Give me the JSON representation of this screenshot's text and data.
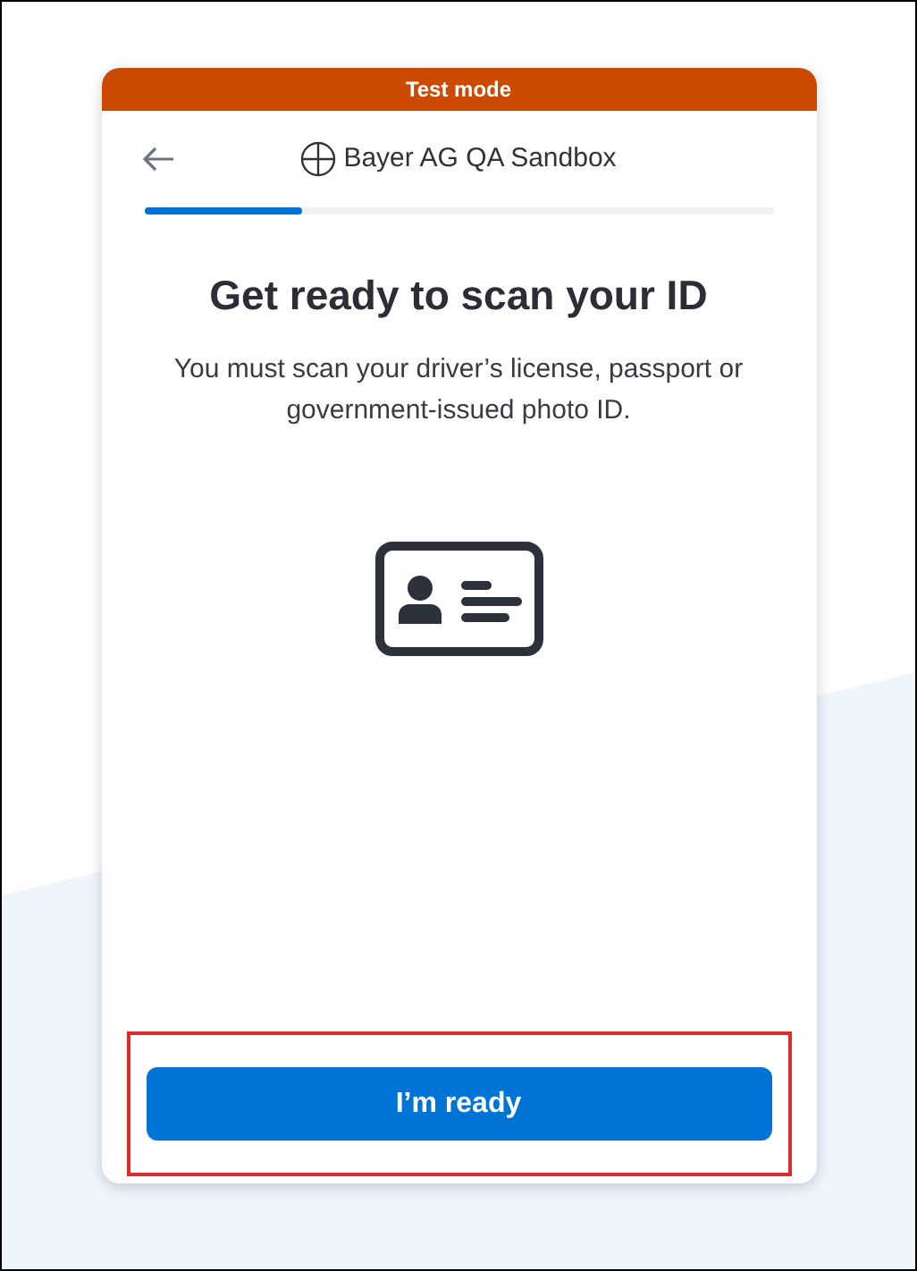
{
  "banner": {
    "text": "Test mode"
  },
  "header": {
    "title": "Bayer AG QA Sandbox"
  },
  "progress": {
    "level": 0.25
  },
  "heading": "Get ready to scan your ID",
  "description": "You must scan your driver’s license, passport or government-issued photo ID.",
  "button": {
    "label": "I’m ready",
    "highlighted": true
  }
}
